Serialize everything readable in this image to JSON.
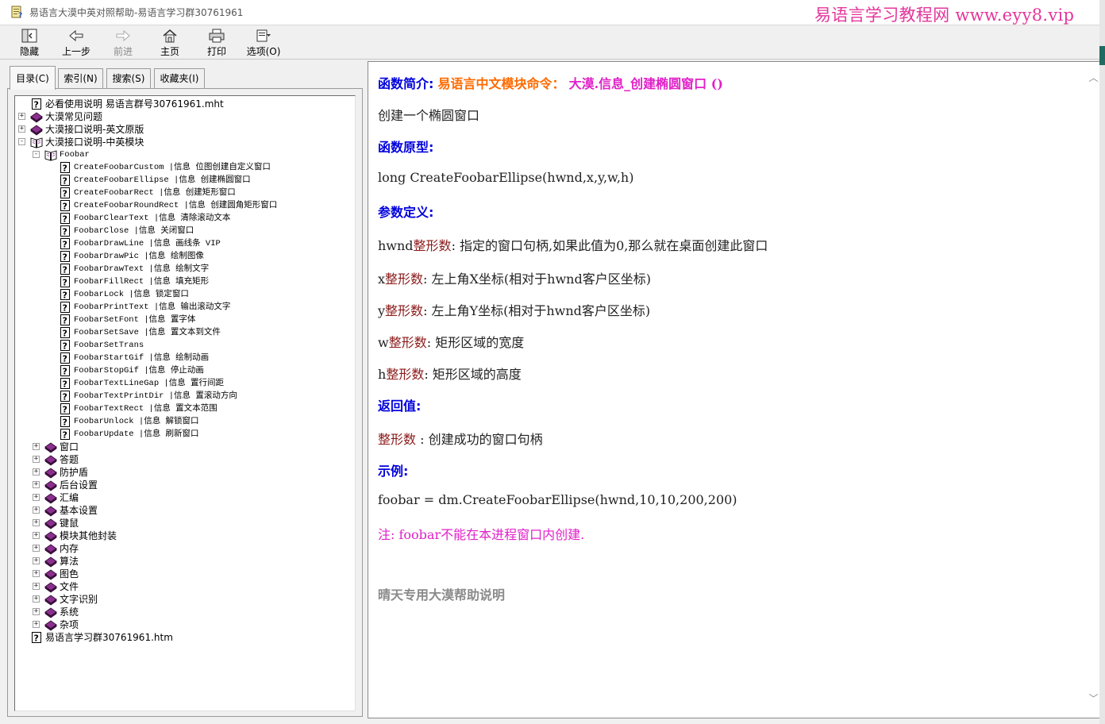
{
  "window": {
    "title": "易语言大漠中英对照帮助-易语言学习群30761961",
    "watermark": "易语言学习教程网 www.eyy8.vip"
  },
  "toolbar": {
    "hide": "隐藏",
    "back": "上一步",
    "forward": "前进",
    "home": "主页",
    "print": "打印",
    "options": "选项(O)"
  },
  "tabs": {
    "contents": "目录(C)",
    "index": "索引(N)",
    "search": "搜索(S)",
    "favorites": "收藏夹(I)"
  },
  "tree": {
    "root_items": {
      "readme": "必看使用说明 易语言群号30761961.mht",
      "faq": "大漠常见问题",
      "en_doc": "大漠接口说明-英文原版",
      "cn_doc": "大漠接口说明-中英模块"
    },
    "foobar_folder": "Foobar",
    "foobar_pages": [
      "CreateFoobarCustom |信息 位图创建自定义窗口",
      "CreateFoobarEllipse |信息 创建椭圆窗口",
      "CreateFoobarRect |信息 创建矩形窗口",
      "CreateFoobarRoundRect |信息 创建圆角矩形窗口",
      "FoobarClearText |信息 清除滚动文本",
      "FoobarClose |信息 关闭窗口",
      "FoobarDrawLine |信息 画线条 VIP",
      "FoobarDrawPic |信息 绘制图像",
      "FoobarDrawText |信息 绘制文字",
      "FoobarFillRect |信息 填充矩形",
      "FoobarLock |信息 锁定窗口",
      "FoobarPrintText |信息 输出滚动文字",
      "FoobarSetFont |信息 置字体",
      "FoobarSetSave |信息 置文本到文件",
      "FoobarSetTrans",
      "FoobarStartGif |信息 绘制动画",
      "FoobarStopGif |信息 停止动画",
      "FoobarTextLineGap |信息 置行间距",
      "FoobarTextPrintDir |信息 置滚动方向",
      "FoobarTextRect |信息 置文本范围",
      "FoobarUnlock |信息 解锁窗口",
      "FoobarUpdate |信息 刷新窗口"
    ],
    "sub_folders": [
      "窗口",
      "答题",
      "防护盾",
      "后台设置",
      "汇编",
      "基本设置",
      "键鼠",
      "模块其他封装",
      "内存",
      "算法",
      "图色",
      "文件",
      "文字识别",
      "系统",
      "杂项"
    ],
    "last_item": "易语言学习群30761961.htm"
  },
  "doc": {
    "intro_label": "函数简介:",
    "intro_module": "易语言中文模块命令：",
    "intro_cmd": "大漠.信息_创建椭圆窗口 ()",
    "description": "创建一个椭圆窗口",
    "proto_label": "函数原型:",
    "prototype": "long CreateFoobarEllipse(hwnd,x,y,w,h)",
    "params_label": "参数定义:",
    "params": [
      {
        "name": "hwnd",
        "type": "整形数",
        "desc": ": 指定的窗口句柄,如果此值为0,那么就在桌面创建此窗口"
      },
      {
        "name": "x",
        "type": "整形数",
        "desc": ": 左上角X坐标(相对于hwnd客户区坐标)"
      },
      {
        "name": "y",
        "type": "整形数",
        "desc": ": 左上角Y坐标(相对于hwnd客户区坐标)"
      },
      {
        "name": "w",
        "type": "整形数",
        "desc": ": 矩形区域的宽度"
      },
      {
        "name": "h",
        "type": "整形数",
        "desc": ": 矩形区域的高度"
      }
    ],
    "return_label": "返回值:",
    "return_type": "整形数",
    "return_desc": " : 创建成功的窗口句柄",
    "example_label": "示例:",
    "example_code": "foobar = dm.CreateFoobarEllipse(hwnd,10,10,200,200)",
    "note": "注: foobar不能在本进程窗口内创建.",
    "footer": "晴天专用大漠帮助说明"
  },
  "colors": {
    "heading": "#0000dd",
    "module": "#ff6a00",
    "command": "#e020c8",
    "param_type": "#8b1a1a",
    "book_icon": "#8b2f8f",
    "watermark": "#e5359b"
  }
}
